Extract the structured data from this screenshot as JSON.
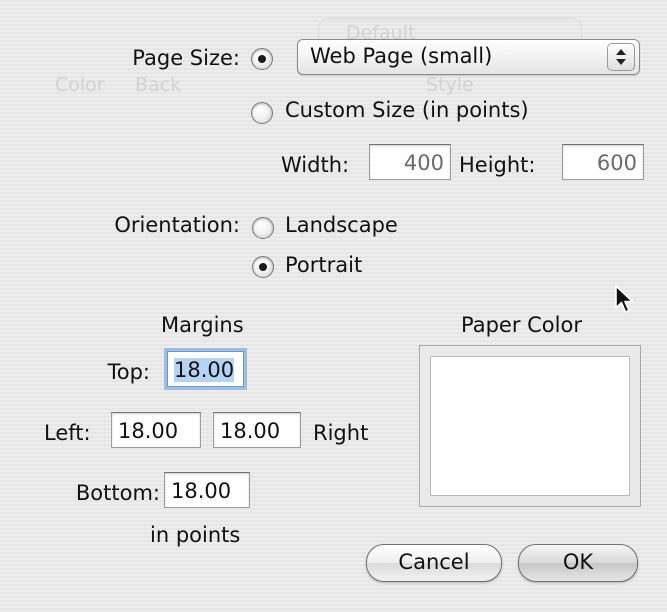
{
  "background": {
    "ghost_toolbar_items": [
      "Color",
      "Back",
      "Default",
      "Style"
    ]
  },
  "page_size": {
    "label": "Page Size:",
    "popup_value": "Web Page (small)",
    "custom_label": "Custom Size (in points)",
    "width_label": "Width:",
    "width_value": "400",
    "height_label": "Height:",
    "height_value": "600"
  },
  "orientation": {
    "label": "Orientation:",
    "landscape_label": "Landscape",
    "portrait_label": "Portrait",
    "selected": "portrait"
  },
  "margins": {
    "title": "Margins",
    "top_label": "Top:",
    "top_value": "18.00",
    "left_label": "Left:",
    "left_value": "18.00",
    "right_value": "18.00",
    "right_label": "Right",
    "bottom_label": "Bottom:",
    "bottom_value": "18.00",
    "units_note": "in points"
  },
  "paper_color": {
    "title": "Paper Color",
    "color": "#ffffff"
  },
  "buttons": {
    "cancel": "Cancel",
    "ok": "OK"
  }
}
